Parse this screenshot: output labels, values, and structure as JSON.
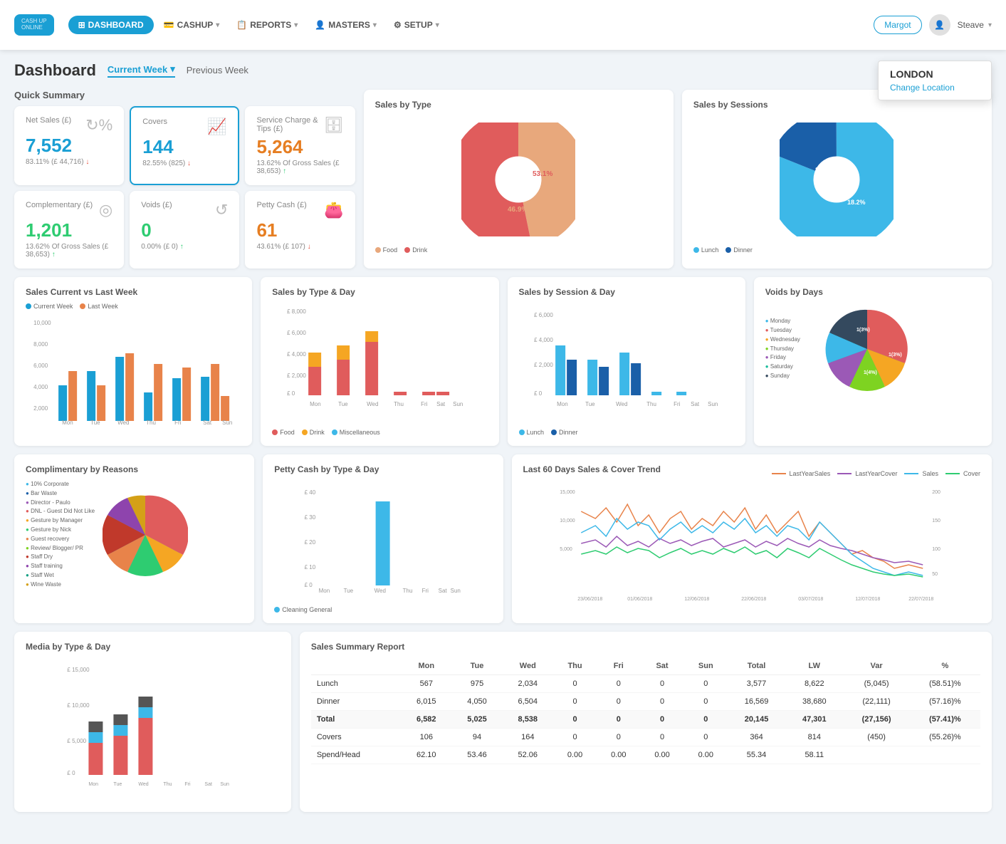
{
  "app": {
    "logo_line1": "CASH UP",
    "logo_line2": "ONLINE"
  },
  "nav": {
    "dashboard_label": "DASHBOARD",
    "cashup_label": "CASHUP",
    "reports_label": "REPORTS",
    "masters_label": "MASTERS",
    "setup_label": "SETUP"
  },
  "header": {
    "margot_label": "Margot",
    "user_label": "Steave",
    "location_name": "LONDON",
    "location_change": "Change Location"
  },
  "page": {
    "title": "Dashboard",
    "tab_current": "Current Week",
    "tab_previous": "Previous Week"
  },
  "quick_summary": {
    "label": "Quick Summary",
    "net_sales_title": "Net Sales (£)",
    "net_sales_value": "7,552",
    "net_sales_sub": "83.11% (£ 44,716)",
    "covers_title": "Covers",
    "covers_value": "144",
    "covers_sub": "82.55% (825)",
    "service_title": "Service Charge & Tips (£)",
    "service_value": "5,264",
    "service_sub": "13.62% Of Gross Sales (£ 38,653)",
    "complementary_title": "Complementary (£)",
    "complementary_value": "1,201",
    "complementary_sub": "13.62% Of Gross Sales (£ 38,653)",
    "voids_title": "Voids (£)",
    "voids_value": "0",
    "voids_sub": "0.00% (£ 0)",
    "petty_title": "Petty Cash (£)",
    "petty_value": "61",
    "petty_sub": "43.61% (£ 107)"
  },
  "charts": {
    "sales_by_type_title": "Sales by Type",
    "sales_by_sessions_title": "Sales by Sessions",
    "sales_current_vs_last_title": "Sales Current vs Last Week",
    "sales_by_type_day_title": "Sales by Type & Day",
    "sales_by_session_day_title": "Sales by Session & Day",
    "voids_by_days_title": "Voids by Days",
    "complimentary_title": "Complimentary by Reasons",
    "petty_cash_title": "Petty Cash by Type & Day",
    "last60_title": "Last 60 Days Sales & Cover Trend",
    "media_title": "Media by Type & Day"
  },
  "sales_type_legend": [
    {
      "label": "Food",
      "color": "#e8a87c"
    },
    {
      "label": "Drink",
      "color": "#e05c5c"
    }
  ],
  "sessions_legend": [
    {
      "label": "Lunch",
      "color": "#3db8e8"
    },
    {
      "label": "Dinner",
      "color": "#1a5fa8"
    }
  ],
  "voids_legend": [
    {
      "label": "Monday",
      "color": "#3db8e8"
    },
    {
      "label": "Tuesday",
      "color": "#e05c5c"
    },
    {
      "label": "Wednesday",
      "color": "#f5a623"
    },
    {
      "label": "Thursday",
      "color": "#7ed321"
    },
    {
      "label": "Friday",
      "color": "#9b59b6"
    },
    {
      "label": "Saturday",
      "color": "#1abc9c"
    },
    {
      "label": "Sunday",
      "color": "#34495e"
    }
  ],
  "current_vs_last_legend": [
    {
      "label": "Current Week",
      "color": "#1a9fd4"
    },
    {
      "label": "Last Week",
      "color": "#e8834a"
    }
  ],
  "type_day_legend": [
    {
      "label": "Food",
      "color": "#e05c5c"
    },
    {
      "label": "Drink",
      "color": "#f5a623"
    },
    {
      "label": "Miscellaneous",
      "color": "#3db8e8"
    }
  ],
  "session_day_legend": [
    {
      "label": "Lunch",
      "color": "#3db8e8"
    },
    {
      "label": "Dinner",
      "color": "#1a5fa8"
    }
  ],
  "last60_legend": [
    {
      "label": "LastYearSales",
      "color": "#e8834a"
    },
    {
      "label": "LastYearCover",
      "color": "#9b59b6"
    },
    {
      "label": "Sales",
      "color": "#1a9fd4"
    },
    {
      "label": "Cover",
      "color": "#2ecc71"
    }
  ],
  "complimentary_legend": [
    {
      "label": "10% Corporate",
      "color": "#3db8e8"
    },
    {
      "label": "Bar Waste",
      "color": "#1a5fa8"
    },
    {
      "label": "Director - Paulo",
      "color": "#9b59b6"
    },
    {
      "label": "DNL - Guest Did Not Like",
      "color": "#e05c5c"
    },
    {
      "label": "Gesture by Manager",
      "color": "#f5a623"
    },
    {
      "label": "Gesture by Nick",
      "color": "#2ecc71"
    },
    {
      "label": "Guest recovery",
      "color": "#e8834a"
    },
    {
      "label": "Review/ Blogger/ PR",
      "color": "#7ed321"
    },
    {
      "label": "Staff Dry",
      "color": "#c0392b"
    },
    {
      "label": "Staff training",
      "color": "#8e44ad"
    },
    {
      "label": "Staff Wet",
      "color": "#16a085"
    },
    {
      "label": "Wine Waste",
      "color": "#d4a017"
    }
  ],
  "sales_summary": {
    "title": "Sales Summary Report",
    "columns": [
      "",
      "Mon",
      "Tue",
      "Wed",
      "Thu",
      "Fri",
      "Sat",
      "Sun",
      "Total",
      "LW",
      "Var",
      "%"
    ],
    "rows": [
      {
        "label": "Lunch",
        "mon": "567",
        "tue": "975",
        "wed": "2,034",
        "thu": "0",
        "fri": "0",
        "sat": "0",
        "sun": "0",
        "total": "3,577",
        "lw": "8,622",
        "var": "(5,045)",
        "pct": "(58.51)%",
        "is_total": false
      },
      {
        "label": "Dinner",
        "mon": "6,015",
        "tue": "4,050",
        "wed": "6,504",
        "thu": "0",
        "fri": "0",
        "sat": "0",
        "sun": "0",
        "total": "16,569",
        "lw": "38,680",
        "var": "(22,111)",
        "pct": "(57.16)%",
        "is_total": false
      },
      {
        "label": "Total",
        "mon": "6,582",
        "tue": "5,025",
        "wed": "8,538",
        "thu": "0",
        "fri": "0",
        "sat": "0",
        "sun": "0",
        "total": "20,145",
        "lw": "47,301",
        "var": "(27,156)",
        "pct": "(57.41)%",
        "is_total": true
      },
      {
        "label": "Covers",
        "mon": "106",
        "tue": "94",
        "wed": "164",
        "thu": "0",
        "fri": "0",
        "sat": "0",
        "sun": "0",
        "total": "364",
        "lw": "814",
        "var": "(450)",
        "pct": "(55.26)%",
        "is_total": false
      },
      {
        "label": "Spend/Head",
        "mon": "62.10",
        "tue": "53.46",
        "wed": "52.06",
        "thu": "0.00",
        "fri": "0.00",
        "sat": "0.00",
        "sun": "0.00",
        "total": "55.34",
        "lw": "58.11",
        "var": "",
        "pct": "",
        "is_total": false
      }
    ]
  }
}
